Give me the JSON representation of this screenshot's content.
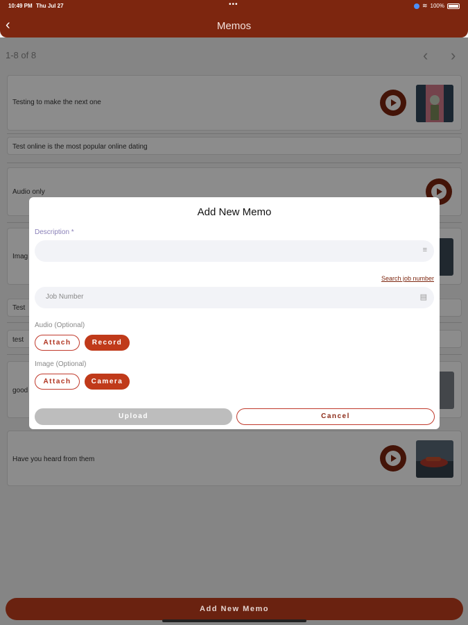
{
  "status_bar": {
    "time": "10:49 PM",
    "date": "Thu Jul 27",
    "dots": "•••",
    "battery": "100%"
  },
  "nav": {
    "back_icon": "chevron-left-icon",
    "title": "Memos"
  },
  "pager": {
    "count": "1-8 of 8",
    "prev_icon": "chevron-left-icon",
    "next_icon": "chevron-right-icon"
  },
  "memos": [
    {
      "text": "Testing to make the next one"
    },
    {
      "text": "Test online is the most popular online dating"
    },
    {
      "text": "Audio only"
    },
    {
      "text": "Imag"
    },
    {
      "text": "Test"
    },
    {
      "text": "test"
    },
    {
      "text": "good"
    },
    {
      "text": "Have you heard from them"
    }
  ],
  "modal": {
    "title": "Add New Memo",
    "description_label": "Description *",
    "search_job_link": "Search job number",
    "job_placeholder": "Job Number",
    "audio_label": "Audio (Optional)",
    "audio_attach": "Attach",
    "audio_record": "Record",
    "image_label": "Image (Optional)",
    "image_attach": "Attach",
    "image_camera": "Camera",
    "upload": "Upload",
    "cancel": "Cancel"
  },
  "bottom": {
    "add_memo": "Add New Memo"
  },
  "colors": {
    "brand": "#7d260f",
    "accent": "#c03a1a"
  }
}
